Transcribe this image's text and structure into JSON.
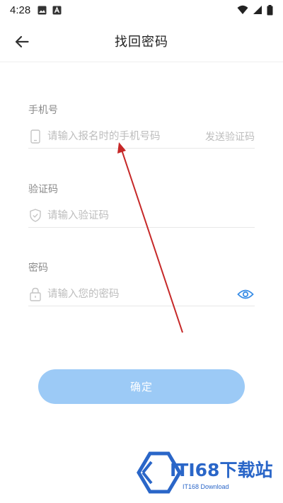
{
  "status_bar": {
    "time": "4:28"
  },
  "header": {
    "back_icon": "arrow-left-icon",
    "title": "找回密码"
  },
  "form": {
    "phone": {
      "label": "手机号",
      "placeholder": "请输入报名时的手机号码",
      "value": "",
      "icon": "phone-icon",
      "send_code_label": "发送验证码"
    },
    "code": {
      "label": "验证码",
      "placeholder": "请输入验证码",
      "value": "",
      "icon": "shield-icon"
    },
    "password": {
      "label": "密码",
      "placeholder": "请输入您的密码",
      "value": "",
      "icon": "lock-icon",
      "toggle_icon": "eye-icon"
    },
    "confirm_label": "确定"
  },
  "colors": {
    "accent": "#3a8ee6",
    "button_disabled": "#9ccaf6",
    "annotation_arrow": "#c62828",
    "watermark": "#2a66c8"
  },
  "watermark": {
    "brand": "ITI68下载站",
    "sub": "IT168 Download"
  }
}
